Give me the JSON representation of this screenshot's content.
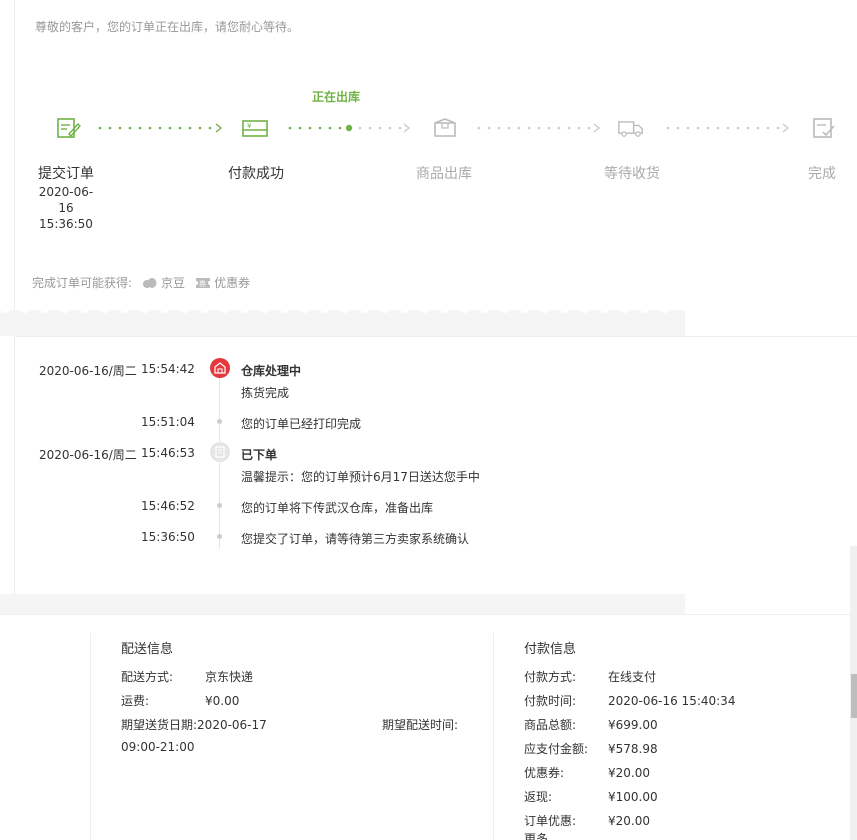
{
  "notice": "尊敬的客户，您的订单正在出库，请您耐心等待。",
  "current_status": "正在出库",
  "steps": [
    {
      "title": "提交订单",
      "date": "2020-06-16",
      "time": "15:36:50"
    },
    {
      "title": "付款成功"
    },
    {
      "title": "商品出库"
    },
    {
      "title": "等待收货"
    },
    {
      "title": "完成"
    }
  ],
  "rewards": {
    "label": "完成订单可能获得:",
    "items": [
      "京豆",
      "优惠券"
    ]
  },
  "tracking": [
    {
      "date": "2020-06-16/周二",
      "time": "15:54:42",
      "title": "仓库处理中",
      "text": "拣货完成"
    },
    {
      "time": "15:51:04",
      "text": "您的订单已经打印完成"
    },
    {
      "date": "2020-06-16/周二",
      "time": "15:46:53",
      "title": "已下单",
      "text": "温馨提示：您的订单预计6月17日送达您手中"
    },
    {
      "time": "15:46:52",
      "text": "您的订单将下传武汉仓库，准备出库"
    },
    {
      "time": "15:36:50",
      "text": "您提交了订单，请等待第三方卖家系统确认"
    }
  ],
  "delivery": {
    "title": "配送信息",
    "method_label": "配送方式:",
    "method": "京东快递",
    "fee_label": "运费:",
    "fee": "¥0.00",
    "date_label": "期望送货日期:",
    "date": "2020-06-17",
    "time_label": "期望配送时间:",
    "time_range": "09:00-21:00"
  },
  "payment": {
    "title": "付款信息",
    "rows": [
      {
        "label": "付款方式:",
        "value": "在线支付"
      },
      {
        "label": "付款时间:",
        "value": "2020-06-16 15:40:34"
      },
      {
        "label": "商品总额:",
        "value": "¥699.00"
      },
      {
        "label": "应支付金额:",
        "value": "¥578.98"
      },
      {
        "label": "优惠券:",
        "value": "¥20.00"
      },
      {
        "label": "返现:",
        "value": "¥100.00"
      },
      {
        "label": "订单优惠:",
        "value": "¥20.00"
      }
    ],
    "more": "更多"
  },
  "colors": {
    "accent": "#71b247",
    "red": "#e4393c",
    "muted": "#aaaaaa"
  }
}
